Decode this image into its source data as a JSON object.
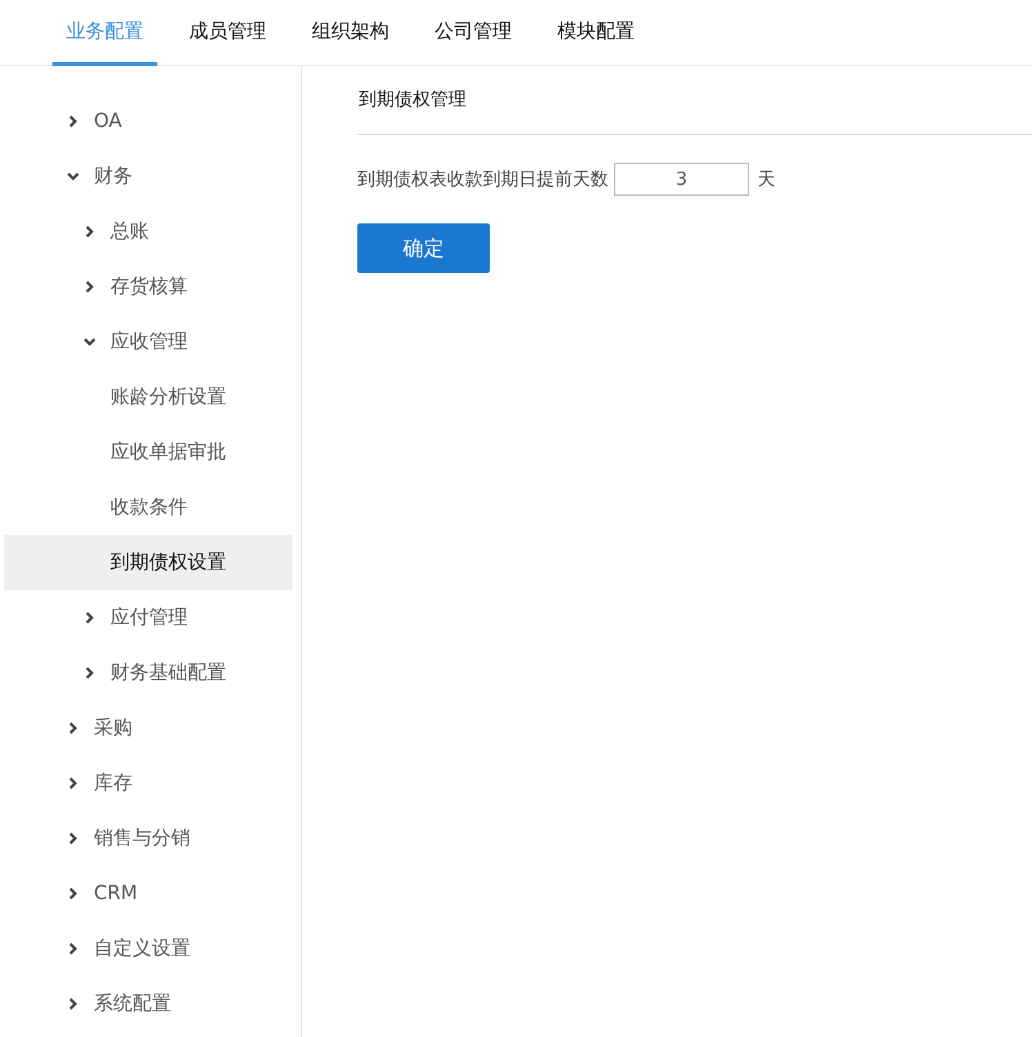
{
  "tabs": [
    {
      "label": "业务配置",
      "selected": true
    },
    {
      "label": "成员管理",
      "selected": false
    },
    {
      "label": "组织架构",
      "selected": false
    },
    {
      "label": "公司管理",
      "selected": false
    },
    {
      "label": "模块配置",
      "selected": false
    }
  ],
  "sidebar": {
    "items": [
      {
        "label": "OA",
        "expanded": false,
        "selected": false
      },
      {
        "label": "财务",
        "expanded": true,
        "selected": false,
        "children": [
          {
            "label": "总账",
            "expanded": false,
            "selected": false
          },
          {
            "label": "存货核算",
            "expanded": false,
            "selected": false
          },
          {
            "label": "应收管理",
            "expanded": true,
            "selected": false,
            "children": [
              {
                "label": "账龄分析设置",
                "selected": false
              },
              {
                "label": "应收单据审批",
                "selected": false
              },
              {
                "label": "收款条件",
                "selected": false
              },
              {
                "label": "到期债权设置",
                "selected": true
              }
            ]
          },
          {
            "label": "应付管理",
            "expanded": false,
            "selected": false
          },
          {
            "label": "财务基础配置",
            "expanded": false,
            "selected": false
          }
        ]
      },
      {
        "label": "采购",
        "expanded": false,
        "selected": false
      },
      {
        "label": "库存",
        "expanded": false,
        "selected": false
      },
      {
        "label": "销售与分销",
        "expanded": false,
        "selected": false
      },
      {
        "label": "CRM",
        "expanded": false,
        "selected": false
      },
      {
        "label": "自定义设置",
        "expanded": false,
        "selected": false
      },
      {
        "label": "系统配置",
        "expanded": false,
        "selected": false
      }
    ]
  },
  "panel": {
    "title": "到期债权管理",
    "field_label": "到期债权表收款到期日提前天数",
    "field_value": "3",
    "unit": "天",
    "button": "确定"
  }
}
